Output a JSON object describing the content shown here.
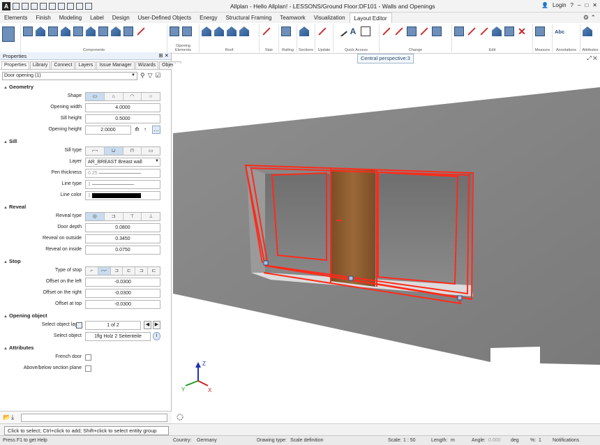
{
  "titlebar": {
    "title": "Allplan - Hello Allplan! - LESSONS/Ground Floor:DF101 - Walls and Openings",
    "login": "Login"
  },
  "menu": {
    "tabs": [
      "Elements",
      "Finish",
      "Modeling",
      "Label",
      "Design",
      "User-Defined Objects",
      "Energy",
      "Structural Framing",
      "Teamwork",
      "Visualization",
      "Layout Editor"
    ],
    "active_tab": "Layout Editor"
  },
  "ribbon": {
    "groups": [
      "Components",
      "Opening Elements",
      "Roof",
      "Stair",
      "Railing",
      "Sections",
      "Update",
      "Quick Access",
      "Change",
      "Edit",
      "Measure",
      "Annotations",
      "Attributes"
    ],
    "annotations_text": "Abc"
  },
  "viewport": {
    "perspective_label": "Central perspective:3",
    "axis_x": "X",
    "axis_y": "Y",
    "axis_z": "Z"
  },
  "properties": {
    "title": "Properties",
    "tabs": [
      "Properties",
      "Library",
      "Connect",
      "Layers",
      "Issue Manager",
      "Wizards",
      "Objects"
    ],
    "selected_object": "Door opening (1)",
    "geometry": {
      "heading": "Geometry",
      "shape_label": "Shape",
      "opening_width_label": "Opening width",
      "opening_width": "4.0000",
      "sill_height_label": "Sill height",
      "sill_height": "0.5000",
      "opening_height_label": "Opening height",
      "opening_height": "2.0000"
    },
    "sill": {
      "heading": "Sill",
      "sill_type_label": "Sill type",
      "layer_label": "Layer",
      "layer": "AR_BREAST  Breast wall",
      "pen_thickness_label": "Pen thickness",
      "pen_thickness": "0.25",
      "line_type_label": "Line type",
      "line_type": "1",
      "line_color_label": "Line color",
      "line_color": "1"
    },
    "reveal": {
      "heading": "Reveal",
      "reveal_type_label": "Reveal type",
      "door_depth_label": "Door depth",
      "door_depth": "0.0800",
      "reveal_outside_label": "Reveal on outside",
      "reveal_outside": "0.3450",
      "reveal_inside_label": "Reveal on inside",
      "reveal_inside": "0.0750"
    },
    "stop": {
      "heading": "Stop",
      "type_label": "Type of stop",
      "offset_left_label": "Offset on the left",
      "offset_left": "-0.0300",
      "offset_right_label": "Offset on the right",
      "offset_right": "-0.0300",
      "offset_top_label": "Offset at top",
      "offset_top": "-0.0300"
    },
    "opening_object": {
      "heading": "Opening object",
      "layer_label": "Select object layer",
      "layer_value": "1 of 2",
      "object_label": "Select object",
      "object_value": "1flg Holz 2 Seitenteile"
    },
    "attributes": {
      "heading": "Attributes",
      "french_door_label": "French door",
      "above_below_label": "Above/below section plane"
    }
  },
  "hint": "Click to select; Ctrl+click to add; Shift+click to select entity group",
  "status": {
    "help": "Press F1 to get Help",
    "country_label": "Country:",
    "country": "Germany",
    "drawing_type_label": "Drawing type:",
    "drawing_type": "Scale definition",
    "scale_label": "Scale:",
    "scale": "1 : 50",
    "length_label": "Length:",
    "length": "m",
    "angle_label": "Angle:",
    "angle": "0.000",
    "angle_unit": "deg",
    "percent_label": "%:",
    "percent": "1",
    "notifications": "Notifications"
  },
  "colors": {
    "accent": "#2c5a93",
    "selection": "#ff2a1a",
    "wall": "#8a8a8a",
    "door_wood": "#8a5a2f"
  }
}
